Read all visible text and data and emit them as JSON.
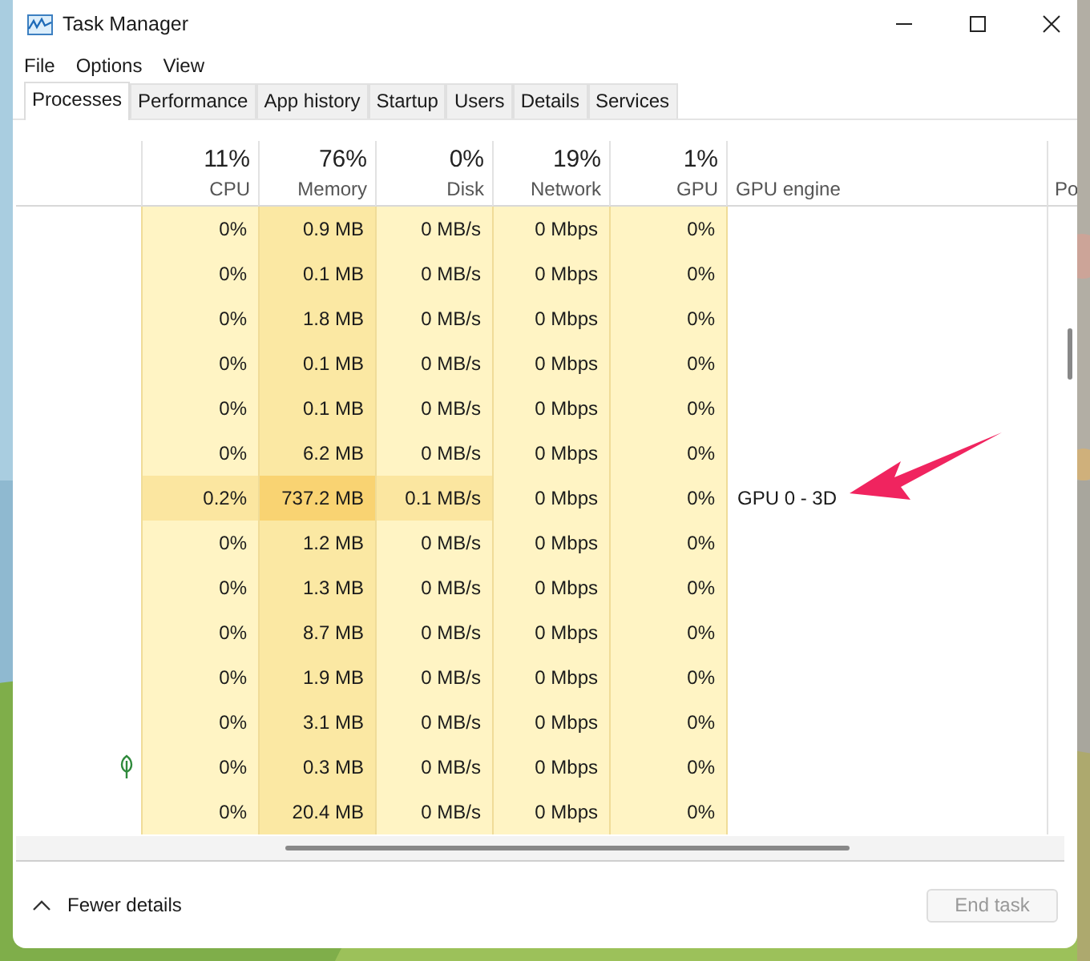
{
  "window": {
    "title": "Task Manager"
  },
  "menu": [
    "File",
    "Options",
    "View"
  ],
  "tabs": [
    {
      "label": "Processes",
      "selected": true
    },
    {
      "label": "Performance",
      "selected": false
    },
    {
      "label": "App history",
      "selected": false
    },
    {
      "label": "Startup",
      "selected": false
    },
    {
      "label": "Users",
      "selected": false
    },
    {
      "label": "Details",
      "selected": false
    },
    {
      "label": "Services",
      "selected": false
    }
  ],
  "columns": [
    {
      "percent": "11%",
      "label": "CPU"
    },
    {
      "percent": "76%",
      "label": "Memory"
    },
    {
      "percent": "0%",
      "label": "Disk"
    },
    {
      "percent": "19%",
      "label": "Network"
    },
    {
      "percent": "1%",
      "label": "GPU"
    }
  ],
  "text_columns": [
    {
      "label": "GPU engine"
    },
    {
      "label": "Po"
    }
  ],
  "rows": [
    {
      "cells": [
        {
          "text": "0%",
          "color": "#fff4c4"
        },
        {
          "text": "0.9 MB",
          "color": "#fbe8a3"
        },
        {
          "text": "0 MB/s",
          "color": "#fff4c4"
        },
        {
          "text": "0 Mbps",
          "color": "#fff4c4"
        },
        {
          "text": "0%",
          "color": "#fff4c4"
        }
      ]
    },
    {
      "cells": [
        {
          "text": "0%",
          "color": "#fff4c4"
        },
        {
          "text": "0.1 MB",
          "color": "#fbe8a3"
        },
        {
          "text": "0 MB/s",
          "color": "#fff4c4"
        },
        {
          "text": "0 Mbps",
          "color": "#fff4c4"
        },
        {
          "text": "0%",
          "color": "#fff4c4"
        }
      ]
    },
    {
      "cells": [
        {
          "text": "0%",
          "color": "#fff4c4"
        },
        {
          "text": "1.8 MB",
          "color": "#fbe8a3"
        },
        {
          "text": "0 MB/s",
          "color": "#fff4c4"
        },
        {
          "text": "0 Mbps",
          "color": "#fff4c4"
        },
        {
          "text": "0%",
          "color": "#fff4c4"
        }
      ]
    },
    {
      "cells": [
        {
          "text": "0%",
          "color": "#fff4c4"
        },
        {
          "text": "0.1 MB",
          "color": "#fbe8a3"
        },
        {
          "text": "0 MB/s",
          "color": "#fff4c4"
        },
        {
          "text": "0 Mbps",
          "color": "#fff4c4"
        },
        {
          "text": "0%",
          "color": "#fff4c4"
        }
      ]
    },
    {
      "cells": [
        {
          "text": "0%",
          "color": "#fff4c4"
        },
        {
          "text": "0.1 MB",
          "color": "#fbe8a3"
        },
        {
          "text": "0 MB/s",
          "color": "#fff4c4"
        },
        {
          "text": "0 Mbps",
          "color": "#fff4c4"
        },
        {
          "text": "0%",
          "color": "#fff4c4"
        }
      ]
    },
    {
      "cells": [
        {
          "text": "0%",
          "color": "#fff4c4"
        },
        {
          "text": "6.2 MB",
          "color": "#fbe8a3"
        },
        {
          "text": "0 MB/s",
          "color": "#fff4c4"
        },
        {
          "text": "0 Mbps",
          "color": "#fff4c4"
        },
        {
          "text": "0%",
          "color": "#fff4c4"
        }
      ]
    },
    {
      "cells": [
        {
          "text": "0.2%",
          "color": "#fbe6a0"
        },
        {
          "text": "737.2 MB",
          "color": "#f9d372"
        },
        {
          "text": "0.1 MB/s",
          "color": "#fbe6a0"
        },
        {
          "text": "0 Mbps",
          "color": "#fff4c4"
        },
        {
          "text": "0%",
          "color": "#fff4c4"
        }
      ],
      "gpu_engine": "GPU 0 - 3D"
    },
    {
      "cells": [
        {
          "text": "0%",
          "color": "#fff4c4"
        },
        {
          "text": "1.2 MB",
          "color": "#fbe8a3"
        },
        {
          "text": "0 MB/s",
          "color": "#fff4c4"
        },
        {
          "text": "0 Mbps",
          "color": "#fff4c4"
        },
        {
          "text": "0%",
          "color": "#fff4c4"
        }
      ]
    },
    {
      "cells": [
        {
          "text": "0%",
          "color": "#fff4c4"
        },
        {
          "text": "1.3 MB",
          "color": "#fbe8a3"
        },
        {
          "text": "0 MB/s",
          "color": "#fff4c4"
        },
        {
          "text": "0 Mbps",
          "color": "#fff4c4"
        },
        {
          "text": "0%",
          "color": "#fff4c4"
        }
      ]
    },
    {
      "cells": [
        {
          "text": "0%",
          "color": "#fff4c4"
        },
        {
          "text": "8.7 MB",
          "color": "#fbe8a3"
        },
        {
          "text": "0 MB/s",
          "color": "#fff4c4"
        },
        {
          "text": "0 Mbps",
          "color": "#fff4c4"
        },
        {
          "text": "0%",
          "color": "#fff4c4"
        }
      ]
    },
    {
      "cells": [
        {
          "text": "0%",
          "color": "#fff4c4"
        },
        {
          "text": "1.9 MB",
          "color": "#fbe8a3"
        },
        {
          "text": "0 MB/s",
          "color": "#fff4c4"
        },
        {
          "text": "0 Mbps",
          "color": "#fff4c4"
        },
        {
          "text": "0%",
          "color": "#fff4c4"
        }
      ]
    },
    {
      "cells": [
        {
          "text": "0%",
          "color": "#fff4c4"
        },
        {
          "text": "3.1 MB",
          "color": "#fbe8a3"
        },
        {
          "text": "0 MB/s",
          "color": "#fff4c4"
        },
        {
          "text": "0 Mbps",
          "color": "#fff4c4"
        },
        {
          "text": "0%",
          "color": "#fff4c4"
        }
      ]
    },
    {
      "efficiency_mode": true,
      "cells": [
        {
          "text": "0%",
          "color": "#fff4c4"
        },
        {
          "text": "0.3 MB",
          "color": "#fbe8a3"
        },
        {
          "text": "0 MB/s",
          "color": "#fff4c4"
        },
        {
          "text": "0 Mbps",
          "color": "#fff4c4"
        },
        {
          "text": "0%",
          "color": "#fff4c4"
        }
      ]
    },
    {
      "cells": [
        {
          "text": "0%",
          "color": "#fff4c4"
        },
        {
          "text": "20.4 MB",
          "color": "#fbe8a3"
        },
        {
          "text": "0 MB/s",
          "color": "#fff4c4"
        },
        {
          "text": "0 Mbps",
          "color": "#fff4c4"
        },
        {
          "text": "0%",
          "color": "#fff4c4"
        }
      ]
    }
  ],
  "footer": {
    "toggle": "Fewer details",
    "button": {
      "label": "End task",
      "disabled": true
    }
  }
}
